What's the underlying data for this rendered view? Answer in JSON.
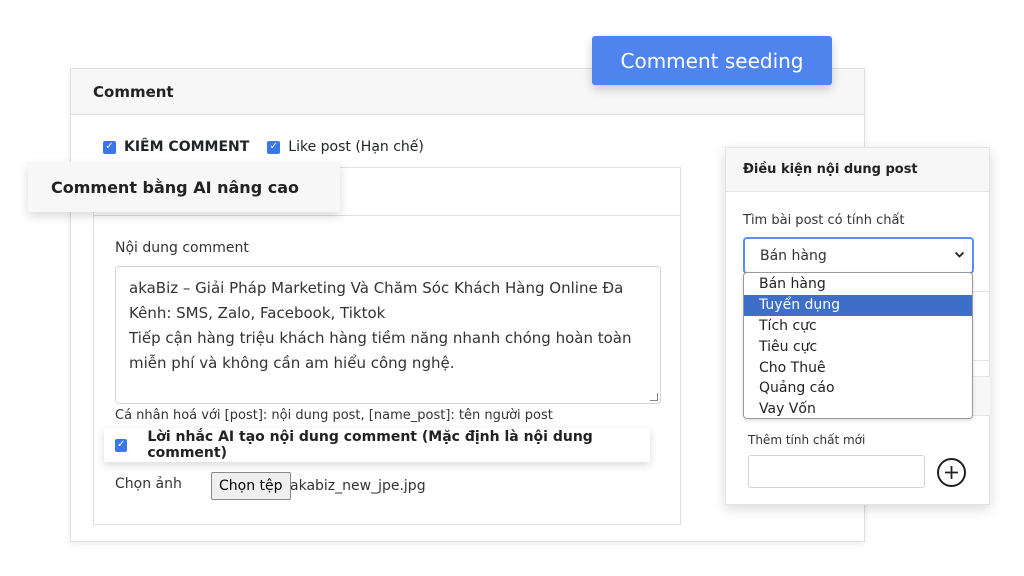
{
  "comment_card": {
    "title": "Comment",
    "kiem_comment_label": "KIÊM COMMENT",
    "like_post_label": "Like post (Hạn chế)"
  },
  "ai_section": {
    "title": "Comment bằng AI nâng cao",
    "content_label": "Nội dung comment",
    "content_value": "akaBiz – Giải Pháp Marketing Và Chăm Sóc Khách Hàng Online Đa Kênh: SMS, Zalo, Facebook, Tiktok\nTiếp cận hàng triệu khách hàng tiềm năng nhanh chóng hoàn toàn miễn phí và không cần am hiểu công nghệ.",
    "personalize_hint": "Cá nhân hoá với [post]: nội dung post, [name_post]: tên người post",
    "ai_reminder_label": "Lời nhắc AI tạo nội dung comment (Mặc định là nội dung comment)",
    "image_label": "Chọn ảnh",
    "choose_file_button": "Chọn tệp",
    "file_name": "akabiz_new_jpe.jpg"
  },
  "seeding_button": "Comment seeding",
  "post_conditions": {
    "title": "Điều kiện nội dung post",
    "find_label": "Tìm bài post có tính chất",
    "selected": "Bán hàng",
    "options": [
      "Bán hàng",
      "Tuyển dụng",
      "Tích cực",
      "Tiêu cực",
      "Cho Thuê",
      "Quảng cáo",
      "Vay Vốn"
    ],
    "highlighted_index": 1,
    "add_label": "Thêm tính chất mới"
  },
  "colors": {
    "accent": "#4f84ef",
    "checkbox": "#3b78e7",
    "highlight": "#3d6fc8"
  }
}
